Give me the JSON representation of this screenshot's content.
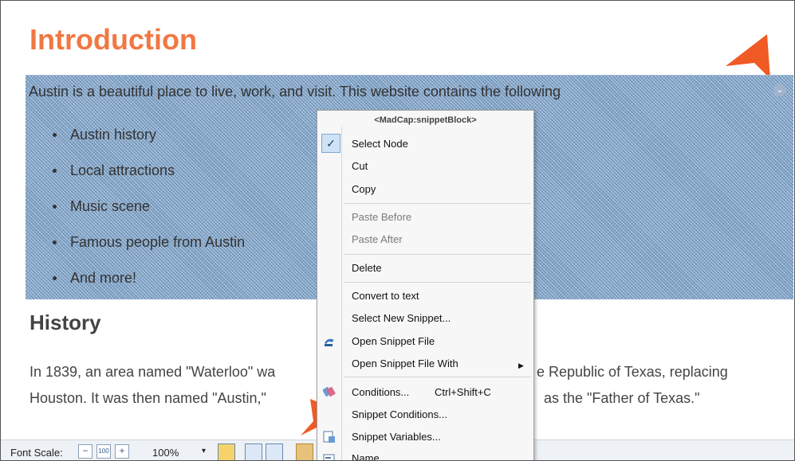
{
  "page": {
    "heading": "Introduction",
    "snippet_intro": "Austin is a beautiful place to live, work, and visit. This website contains the following",
    "bullets": [
      "Austin history",
      "Local attractions",
      "Music scene",
      "Famous people from Austin",
      "And more!"
    ],
    "history_heading": "History",
    "history_line1": "In 1839, an area named \"Waterloo\" wa",
    "history_line1_right": "e Republic of Texas, replacing",
    "history_line2": "Houston. It was then named \"Austin,\"",
    "history_line2_right": "as the \"Father of Texas.\""
  },
  "context_menu": {
    "header": "<MadCap:snippetBlock>",
    "items": {
      "select_node": "Select Node",
      "cut": "Cut",
      "copy": "Copy",
      "paste_before": "Paste Before",
      "paste_after": "Paste After",
      "delete": "Delete",
      "convert_to_text": "Convert to text",
      "select_new_snippet": "Select New Snippet...",
      "open_snippet_file": "Open Snippet File",
      "open_snippet_file_with": "Open Snippet File With",
      "conditions": "Conditions...",
      "conditions_shortcut": "Ctrl+Shift+C",
      "snippet_conditions": "Snippet Conditions...",
      "snippet_variables": "Snippet Variables...",
      "name": "Name..."
    },
    "check_mark": "✓",
    "submenu_arrow": "▶"
  },
  "toolbar": {
    "font_scale_label": "Font Scale:",
    "minus": "−",
    "reset": "100",
    "plus": "+",
    "zoom": "100%",
    "dropdown": "▾"
  },
  "colors": {
    "accent_orange": "#f07842",
    "selection_blue": "#7fa3c7",
    "menu_bg": "#f7f7f7"
  },
  "icons": [
    "chevron-down-icon",
    "open-snippet-icon",
    "conditions-icon",
    "snippet-variables-icon",
    "name-icon",
    "callout-arrow-icon"
  ]
}
